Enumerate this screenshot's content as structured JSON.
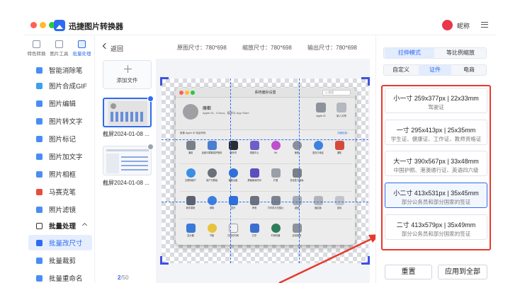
{
  "app": {
    "title": "迅捷图片转换器",
    "user_name": "昵称",
    "accent": "#2e6bf0"
  },
  "tool_tabs": [
    {
      "label": "特色转换",
      "icon": "magic-wand-icon"
    },
    {
      "label": "图片工具",
      "icon": "image-tools-icon"
    },
    {
      "label": "批量处理",
      "icon": "batch-icon"
    }
  ],
  "sidebar": {
    "items": [
      {
        "label": "智能消除笔",
        "icon_color": "#4a8cf6"
      },
      {
        "label": "图片合成GIF",
        "icon_color": "#3aa0f0"
      },
      {
        "label": "图片编辑",
        "icon_color": "#4a8cf6"
      },
      {
        "label": "图片转文字",
        "icon_color": "#4a8cf6"
      },
      {
        "label": "图片标记",
        "icon_color": "#4a8cf6"
      },
      {
        "label": "图片加文字",
        "icon_color": "#4a8cf6"
      },
      {
        "label": "照片相框",
        "icon_color": "#4a8cf6"
      },
      {
        "label": "马赛克笔",
        "icon_color": "#e74c3c"
      },
      {
        "label": "照片滤镜",
        "icon_color": "#4a8cf6"
      }
    ],
    "section": {
      "label": "批量处理"
    },
    "sub_items": [
      {
        "label": "批量改尺寸",
        "active": true
      },
      {
        "label": "批量裁剪",
        "active": false
      },
      {
        "label": "批量重命名",
        "active": false
      }
    ]
  },
  "toolbar": {
    "back_label": "返回",
    "original_size": "原图尺寸：780*698",
    "scaled_size": "缩放尺寸：780*698",
    "output_size": "输出尺寸：780*698"
  },
  "file_list": {
    "add_label": "添加文件",
    "files": [
      {
        "caption": "截屏2024-01-08 ..."
      },
      {
        "caption": "截屏2024-01-08 ..."
      }
    ],
    "page_current": "2",
    "page_total": "/50"
  },
  "preview": {
    "window_title": "系统偏好设置",
    "search_placeholder": "Q 搜索",
    "user_name": "魔都",
    "user_sub": "Apple ID、iCloud、媒体与 App Store",
    "right_icons": [
      {
        "label": "Apple ID"
      },
      {
        "label": "家人共享"
      }
    ],
    "banner": "就像 Apple ID 电话号码",
    "banner_link": "详细信息...",
    "rows": [
      [
        "通用",
        "桌面与屏幕保护程序",
        "程序坞",
        "调度中心",
        "Siri",
        "聚焦",
        "语言与地区",
        "通知"
      ],
      [
        "互联网帐户",
        "用户与群组",
        "辅助功能",
        "屏幕使用时间",
        "扩展",
        "安全性与隐私"
      ],
      [
        "软件更新",
        "网络",
        "蓝牙",
        "声音",
        "打印机与扫描仪",
        "键盘",
        "触控板",
        "鼠标"
      ],
      [
        "显示器",
        "节能",
        "日期与时间",
        "共享",
        "时间机器",
        "启动磁盘"
      ]
    ]
  },
  "right_panel": {
    "mode_tabs": [
      {
        "label": "拉伸模式",
        "active": true
      },
      {
        "label": "等比例缩放",
        "active": false
      }
    ],
    "type_tabs": [
      {
        "label": "自定义",
        "active": false
      },
      {
        "label": "证件",
        "active": true
      },
      {
        "label": "电商",
        "active": false
      }
    ],
    "presets": [
      {
        "title": "小一寸 259x377px | 22x33mm",
        "desc": "驾驶证"
      },
      {
        "title": "一寸 295x413px | 25x35mm",
        "desc": "学生证、健康证、工作证、教师资格证"
      },
      {
        "title": "大一寸 390x567px | 33x48mm",
        "desc": "中国护照、港澳通行证、英语四六级"
      },
      {
        "title": "小二寸 413x531px | 35x45mm",
        "desc": "部分公务员和部分国家的签证"
      },
      {
        "title": "二寸 413x579px | 35x49mm",
        "desc": "部分公务员和部分国家的签证"
      }
    ],
    "reset_label": "重置",
    "apply_all_label": "应用到全部"
  },
  "colors": {
    "highlight_red": "#e7392d",
    "checker": "#d9dbe0"
  }
}
